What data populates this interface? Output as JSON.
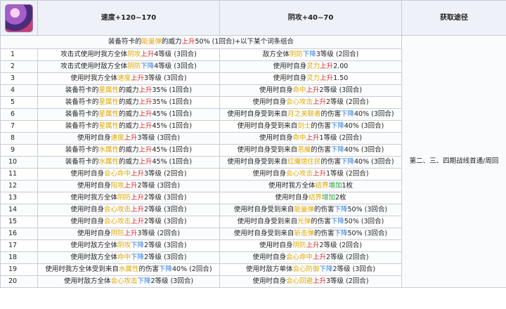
{
  "colors": {
    "yellow": "#e1a800",
    "red": "#e02424",
    "blue": "#2b7be0",
    "green": "#23a13b",
    "pink": "#d548c8"
  },
  "header": {
    "avatar_icon": "character-portrait",
    "col_speed": "速度+120~170",
    "col_attack": "阴攻+40~70",
    "col_acquire": "获取途径"
  },
  "intro": {
    "pre": "装备符卡的",
    "hl1": "能量弹",
    "mid": "的威力",
    "hl2": "上升",
    "post": "50% (1回合)+以下某个词条组合"
  },
  "acquire": "第二、三、四期战线首通/周回",
  "rows": [
    {
      "n": "1",
      "a": [
        [
          "t",
          "攻击式使用时我方全体"
        ],
        [
          "y",
          "阴攻"
        ],
        [
          "r",
          "上升"
        ],
        [
          "t",
          "4等级 (3回合)"
        ]
      ],
      "b": [
        [
          "t",
          "敌方全体"
        ],
        [
          "y",
          "阴防"
        ],
        [
          "b",
          "下降"
        ],
        [
          "t",
          "3等级 (2回合)"
        ]
      ]
    },
    {
      "n": "2",
      "a": [
        [
          "t",
          "攻击式使用时敌方全体"
        ],
        [
          "y",
          "阴防"
        ],
        [
          "b",
          "下降"
        ],
        [
          "t",
          "4等级 (3回合)"
        ]
      ],
      "b": [
        [
          "t",
          "使用时自身"
        ],
        [
          "y",
          "灵力"
        ],
        [
          "r",
          "上升"
        ],
        [
          "t",
          "2.00"
        ]
      ]
    },
    {
      "n": "3",
      "a": [
        [
          "t",
          "使用时我方全体"
        ],
        [
          "y",
          "速度"
        ],
        [
          "r",
          "上升"
        ],
        [
          "t",
          "3等级 (3回合)"
        ]
      ],
      "b": [
        [
          "t",
          "使用时自身"
        ],
        [
          "y",
          "灵力"
        ],
        [
          "r",
          "上升"
        ],
        [
          "t",
          "1.50"
        ]
      ]
    },
    {
      "n": "4",
      "a": [
        [
          "t",
          "装备符卡的"
        ],
        [
          "y",
          "星属性"
        ],
        [
          "t",
          "的威力"
        ],
        [
          "r",
          "上升"
        ],
        [
          "t",
          "35% (1回合)"
        ]
      ],
      "b": [
        [
          "t",
          "使用时自身"
        ],
        [
          "y",
          "命中"
        ],
        [
          "r",
          "上升"
        ],
        [
          "t",
          "2等级 (3回合)"
        ]
      ]
    },
    {
      "n": "5",
      "a": [
        [
          "t",
          "装备符卡的"
        ],
        [
          "y",
          "星属性"
        ],
        [
          "t",
          "的威力"
        ],
        [
          "r",
          "上升"
        ],
        [
          "t",
          "35% (1回合)"
        ]
      ],
      "b": [
        [
          "t",
          "使用时自身"
        ],
        [
          "y",
          "会心攻击"
        ],
        [
          "r",
          "上升"
        ],
        [
          "t",
          "2等级 (2回合)"
        ]
      ]
    },
    {
      "n": "6",
      "a": [
        [
          "t",
          "装备符卡的"
        ],
        [
          "y",
          "星属性"
        ],
        [
          "t",
          "的威力"
        ],
        [
          "r",
          "上升"
        ],
        [
          "t",
          "45% (1回合)"
        ]
      ],
      "b": [
        [
          "t",
          "使用时自身受到来自"
        ],
        [
          "y",
          "月之关联者"
        ],
        [
          "t",
          "的伤害"
        ],
        [
          "b",
          "下降"
        ],
        [
          "t",
          "40% (3回合)"
        ]
      ]
    },
    {
      "n": "7",
      "a": [
        [
          "t",
          "装备符卡的"
        ],
        [
          "y",
          "星属性"
        ],
        [
          "t",
          "的威力"
        ],
        [
          "r",
          "上升"
        ],
        [
          "t",
          "45% (1回合)"
        ]
      ],
      "b": [
        [
          "t",
          "使用时自身受到来自"
        ],
        [
          "y",
          "剑士"
        ],
        [
          "t",
          "的伤害"
        ],
        [
          "b",
          "下降"
        ],
        [
          "t",
          "40% (3回合)"
        ]
      ]
    },
    {
      "n": "8",
      "a": [
        [
          "t",
          "使用时自身"
        ],
        [
          "y",
          "速度"
        ],
        [
          "r",
          "上升"
        ],
        [
          "t",
          "3等级 (3回合)"
        ]
      ],
      "b": [
        [
          "t",
          "使用时自身"
        ],
        [
          "y",
          "命中"
        ],
        [
          "r",
          "上升"
        ],
        [
          "t",
          "1等级 (2回合)"
        ]
      ]
    },
    {
      "n": "9",
      "a": [
        [
          "t",
          "装备符卡的"
        ],
        [
          "y",
          "水属性"
        ],
        [
          "t",
          "的威力"
        ],
        [
          "r",
          "上升"
        ],
        [
          "t",
          "45% (1回合)"
        ]
      ],
      "b": [
        [
          "t",
          "使用时自身受到来自"
        ],
        [
          "y",
          "恶魔"
        ],
        [
          "t",
          "的伤害"
        ],
        [
          "b",
          "下降"
        ],
        [
          "t",
          "40% (3回合)"
        ]
      ]
    },
    {
      "n": "10",
      "a": [
        [
          "t",
          "装备符卡的"
        ],
        [
          "y",
          "水属性"
        ],
        [
          "t",
          "的威力"
        ],
        [
          "r",
          "上升"
        ],
        [
          "t",
          "45% (1回合)"
        ]
      ],
      "b": [
        [
          "t",
          "使用时自身受到来自"
        ],
        [
          "y",
          "红魔馆住民"
        ],
        [
          "t",
          "的伤害"
        ],
        [
          "b",
          "下降"
        ],
        [
          "t",
          "40% (3回合)"
        ]
      ]
    },
    {
      "n": "11",
      "a": [
        [
          "t",
          "使用时自身"
        ],
        [
          "y",
          "会心命中"
        ],
        [
          "r",
          "上升"
        ],
        [
          "t",
          "3等级 (2回合)"
        ]
      ],
      "b": [
        [
          "t",
          "使用时自身"
        ],
        [
          "y",
          "会心攻击"
        ],
        [
          "r",
          "上升"
        ],
        [
          "t",
          "1等级 (2回合)"
        ]
      ]
    },
    {
      "n": "12",
      "a": [
        [
          "t",
          "使用时自身"
        ],
        [
          "y",
          "阳攻"
        ],
        [
          "r",
          "上升"
        ],
        [
          "t",
          "2等级 (3回合)"
        ]
      ],
      "b": [
        [
          "t",
          "使用时我方全体"
        ],
        [
          "y",
          "结界"
        ],
        [
          "g",
          "增加"
        ],
        [
          "t",
          "1枚"
        ]
      ]
    },
    {
      "n": "13",
      "a": [
        [
          "t",
          "使用时我方全体"
        ],
        [
          "y",
          "阴防"
        ],
        [
          "r",
          "上升"
        ],
        [
          "t",
          "2等级 (3回合)"
        ]
      ],
      "b": [
        [
          "t",
          "使用时自身"
        ],
        [
          "y",
          "结界"
        ],
        [
          "g",
          "增加"
        ],
        [
          "t",
          "2枚"
        ]
      ]
    },
    {
      "n": "14",
      "a": [
        [
          "t",
          "使用时自身"
        ],
        [
          "y",
          "会心攻击"
        ],
        [
          "r",
          "上升"
        ],
        [
          "t",
          "2等级 (3回合)"
        ]
      ],
      "b": [
        [
          "t",
          "使用时自身受到来自"
        ],
        [
          "y",
          "能量弹"
        ],
        [
          "t",
          "的伤害"
        ],
        [
          "b",
          "下降"
        ],
        [
          "t",
          "50% (3回合)"
        ]
      ]
    },
    {
      "n": "15",
      "a": [
        [
          "t",
          "使用时自身"
        ],
        [
          "y",
          "会心攻击"
        ],
        [
          "r",
          "上升"
        ],
        [
          "t",
          "2等级 (3回合)"
        ]
      ],
      "b": [
        [
          "t",
          "使用时自身受到来自"
        ],
        [
          "y",
          "光弹"
        ],
        [
          "t",
          "的伤害"
        ],
        [
          "b",
          "下降"
        ],
        [
          "t",
          "50% (3回合)"
        ]
      ]
    },
    {
      "n": "16",
      "a": [
        [
          "t",
          "使用时自身"
        ],
        [
          "y",
          "阴防"
        ],
        [
          "r",
          "上升"
        ],
        [
          "t",
          "3等级 (2回合)"
        ]
      ],
      "b": [
        [
          "t",
          "使用时自身受到来自"
        ],
        [
          "y",
          "斩击弹"
        ],
        [
          "t",
          "的伤害"
        ],
        [
          "b",
          "下降"
        ],
        [
          "t",
          "50% (3回合)"
        ]
      ]
    },
    {
      "n": "17",
      "a": [
        [
          "t",
          "使用时敌方全体"
        ],
        [
          "y",
          "阴攻"
        ],
        [
          "b",
          "下降"
        ],
        [
          "t",
          "2等级 (3回合)"
        ]
      ],
      "b": [
        [
          "t",
          "使用时自身"
        ],
        [
          "y",
          "阴防"
        ],
        [
          "r",
          "上升"
        ],
        [
          "t",
          "2等级 (2回合)"
        ]
      ]
    },
    {
      "n": "18",
      "a": [
        [
          "t",
          "使用时敌方全体"
        ],
        [
          "y",
          "命中"
        ],
        [
          "b",
          "下降"
        ],
        [
          "t",
          "2等级 (3回合)"
        ]
      ],
      "b": [
        [
          "t",
          "使用时自身"
        ],
        [
          "y",
          "会心命中"
        ],
        [
          "r",
          "上升"
        ],
        [
          "t",
          "2等级 (2回合)"
        ]
      ]
    },
    {
      "n": "19",
      "a": [
        [
          "t",
          "使用时我方全体受到来自"
        ],
        [
          "y",
          "水属性"
        ],
        [
          "t",
          "的伤害"
        ],
        [
          "b",
          "下降"
        ],
        [
          "t",
          "40% (2回合)"
        ]
      ],
      "b": [
        [
          "t",
          "使用时敌方单体"
        ],
        [
          "y",
          "会心防御"
        ],
        [
          "b",
          "下降"
        ],
        [
          "t",
          "2等级 (3回合)"
        ]
      ]
    },
    {
      "n": "20",
      "a": [
        [
          "t",
          "使用时敌方全体"
        ],
        [
          "y",
          "会心攻击"
        ],
        [
          "b",
          "下降"
        ],
        [
          "t",
          "2等级 (3回合)"
        ]
      ],
      "b": [
        [
          "t",
          "使用时自身"
        ],
        [
          "y",
          "会心回避"
        ],
        [
          "r",
          "上升"
        ],
        [
          "t",
          "3等级 (2回合)"
        ]
      ]
    }
  ]
}
